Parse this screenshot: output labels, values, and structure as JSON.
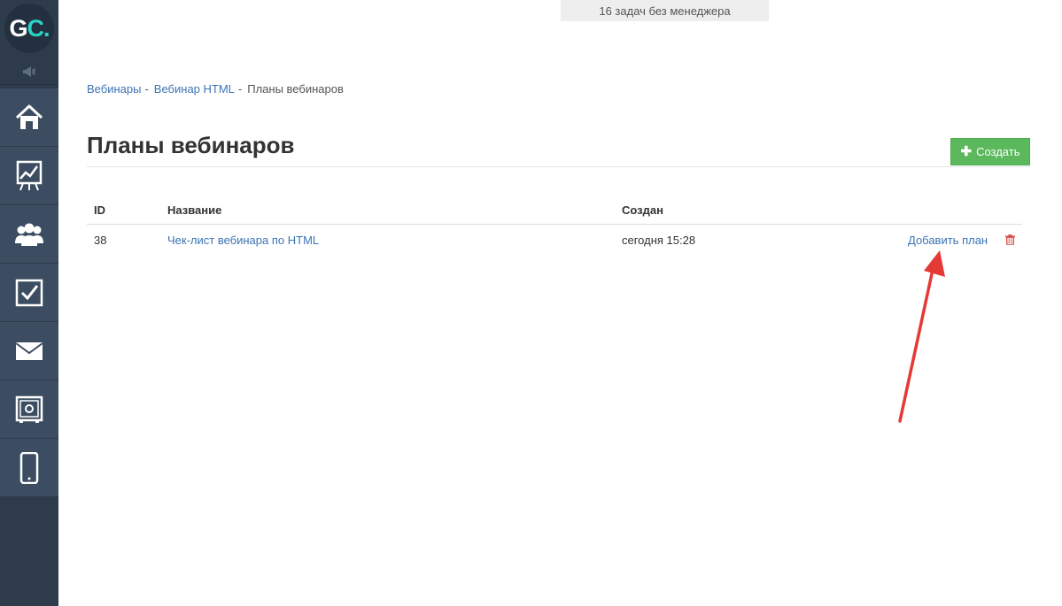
{
  "sidebar": {
    "logo": {
      "letter_g": "G",
      "letter_c": "C.",
      "accent": "#2bd3c6"
    },
    "icons": [
      "speaker-icon",
      "home-icon",
      "chart-icon",
      "users-icon",
      "checkbox-icon",
      "mail-icon",
      "safe-icon",
      "mobile-icon"
    ]
  },
  "top": {
    "tasks_text": "16 задач без менеджера"
  },
  "breadcrumb": {
    "items": [
      "Вебинары",
      "Вебинар HTML",
      "Планы вебинаров"
    ],
    "separator": "-"
  },
  "page": {
    "title": "Планы вебинаров"
  },
  "toolbar": {
    "create_label": "Создать",
    "create_color": "#5cb85c"
  },
  "table": {
    "headers": {
      "id": "ID",
      "name": "Название",
      "created": "Создан"
    },
    "rows": [
      {
        "id": "38",
        "name": "Чек-лист вебинара по HTML",
        "created": "сегодня 15:28",
        "action": "Добавить план"
      }
    ]
  },
  "colors": {
    "link": "#3a74b3",
    "sidebar": "#2e3b4b",
    "delete": "#d9534f",
    "annotation": "#e53935"
  }
}
